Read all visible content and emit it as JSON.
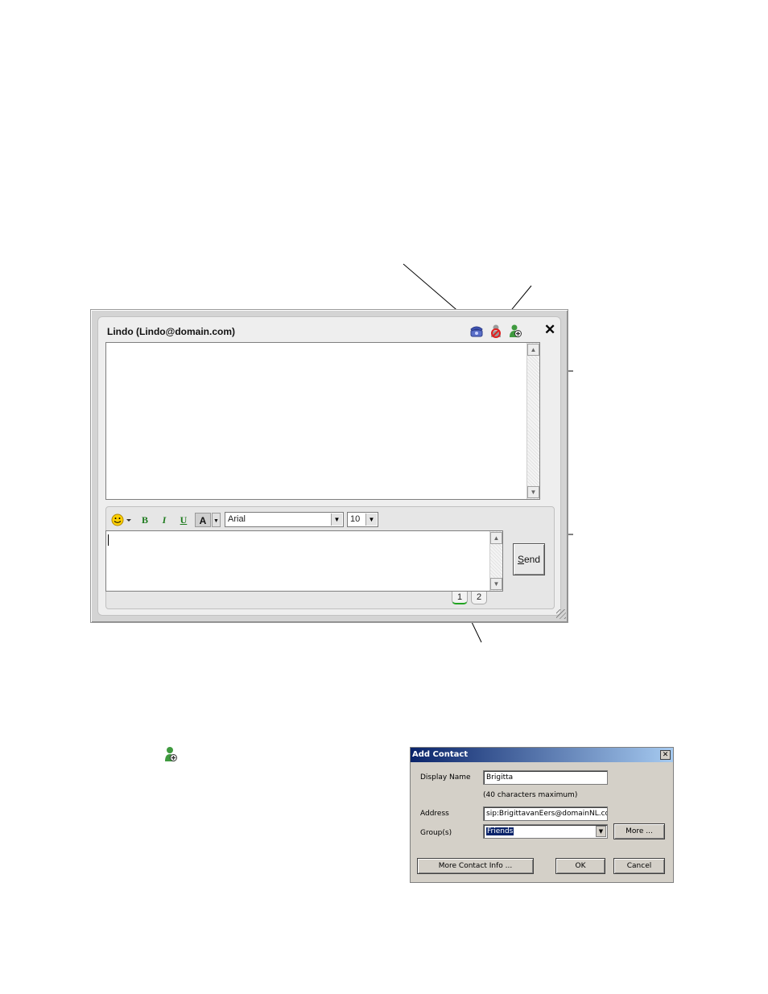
{
  "im_window": {
    "title": "Lindo (Lindo@domain.com)",
    "icons": [
      "phone-icon",
      "block-icon",
      "add-contact-icon"
    ],
    "close_label": "✕",
    "toolbar": {
      "emoticon": "emoticon-icon",
      "bold": "B",
      "italic": "I",
      "underline": "U",
      "font_color": "A",
      "font_name": "Arial",
      "font_size": "10"
    },
    "send_label_accel": "S",
    "send_label_rest": "end",
    "pages": [
      "1",
      "2"
    ]
  },
  "add_contact_dialog": {
    "title": "Add Contact",
    "close_label": "✕",
    "display_name_label": "Display Name",
    "display_name_value": "Brigitta",
    "max_hint": "(40 characters maximum)",
    "address_label": "Address",
    "address_value": "sip:BrigittavanEers@domainNL.com",
    "groups_label": "Group(s)",
    "groups_value": "Friends",
    "more_label": "More ...",
    "more_info_label": "More Contact Info ...",
    "ok_label": "OK",
    "cancel_label": "Cancel"
  },
  "colors": {
    "toolbar_green": "#1e7b1e",
    "dialog_titlebar": "#0a246a",
    "dialog_bg": "#d4d0c8"
  }
}
